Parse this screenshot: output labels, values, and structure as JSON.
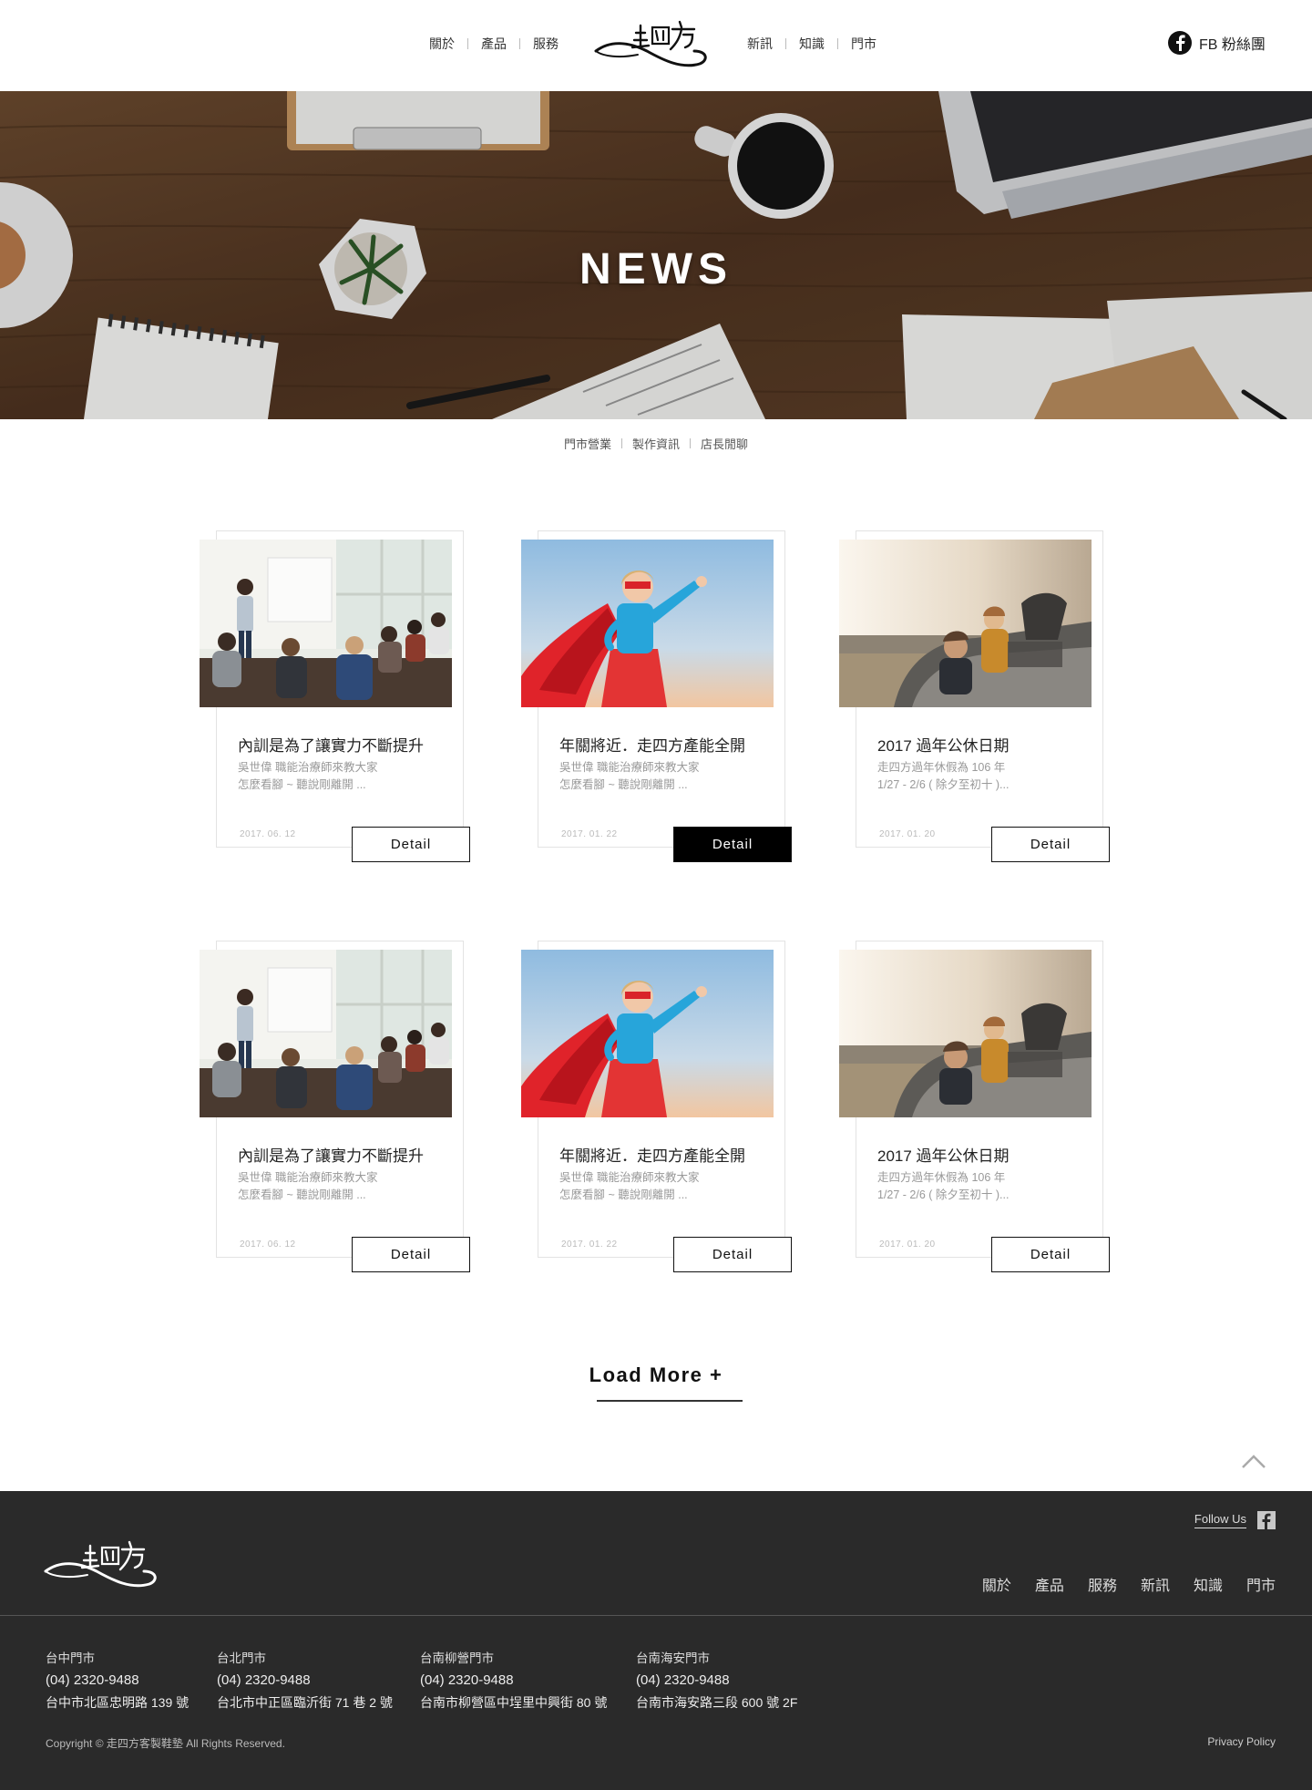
{
  "header": {
    "nav_left": [
      "關於",
      "產品",
      "服務"
    ],
    "nav_right": [
      "新訊",
      "知識",
      "門市"
    ],
    "fb_label": "FB 粉絲團"
  },
  "hero": {
    "title": "NEWS"
  },
  "subnav": [
    "門市營業",
    "製作資訊",
    "店長閒聊"
  ],
  "cards": [
    {
      "title": "內訓是為了讓實力不斷提升",
      "desc_line1": "吳世偉 職能治療師來教大家",
      "desc_line2": "怎麼看腳 ~ 聽說剛離開 ...",
      "date": "2017. 06. 12",
      "button": "Detail",
      "image": "training-photo"
    },
    {
      "title": "年關將近．走四方產能全開",
      "desc_line1": "吳世偉 職能治療師來教大家",
      "desc_line2": "怎麼看腳 ~ 聽說剛離開 ...",
      "date": "2017. 01. 22",
      "button": "Detail",
      "image": "superhero-girl-photo"
    },
    {
      "title": "2017 過年公休日期",
      "desc_line1": "走四方過年休假為 106 年",
      "desc_line2": "1/27 - 2/6 ( 除夕至初十 )...",
      "date": "2017. 01. 20",
      "button": "Detail",
      "image": "family-car-photo"
    },
    {
      "title": "內訓是為了讓實力不斷提升",
      "desc_line1": "吳世偉 職能治療師來教大家",
      "desc_line2": "怎麼看腳 ~ 聽說剛離開 ...",
      "date": "2017. 06. 12",
      "button": "Detail",
      "image": "training-photo"
    },
    {
      "title": "年關將近．走四方產能全開",
      "desc_line1": "吳世偉 職能治療師來教大家",
      "desc_line2": "怎麼看腳 ~ 聽說剛離開 ...",
      "date": "2017. 01. 22",
      "button": "Detail",
      "image": "superhero-girl-photo"
    },
    {
      "title": "2017 過年公休日期",
      "desc_line1": "走四方過年休假為 106 年",
      "desc_line2": "1/27 - 2/6 ( 除夕至初十 )...",
      "date": "2017. 01. 20",
      "button": "Detail",
      "image": "family-car-photo"
    }
  ],
  "load_more": "Load More +",
  "footer": {
    "follow_label": "Follow Us",
    "nav": [
      "關於",
      "產品",
      "服務",
      "新訊",
      "知識",
      "門市"
    ],
    "stores": [
      {
        "name": "台中門市",
        "phone": "(04) 2320-9488",
        "address": "台中市北區忠明路 139 號"
      },
      {
        "name": "台北門市",
        "phone": "(04) 2320-9488",
        "address": "台北市中正區臨沂街 71 巷 2 號"
      },
      {
        "name": "台南柳營門市",
        "phone": "(04) 2320-9488",
        "address": "台南市柳營區中埕里中興街 80 號"
      },
      {
        "name": "台南海安門市",
        "phone": "(04) 2320-9488",
        "address": "台南市海安路三段 600 號 2F"
      }
    ],
    "copyright": "Copyright © 走四方客製鞋墊 All Rights Reserved.",
    "privacy": "Privacy Policy"
  },
  "colors": {
    "footer_bg": "#2a2a2a",
    "active_button_bg": "#000000"
  }
}
